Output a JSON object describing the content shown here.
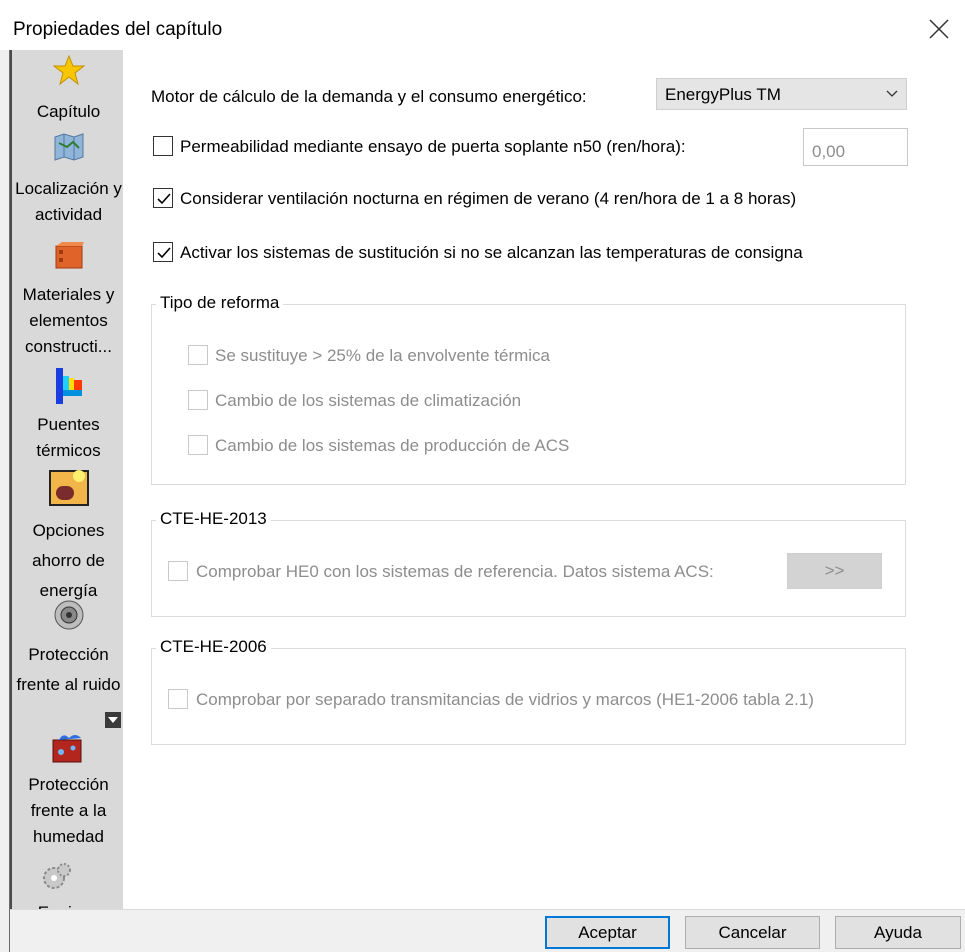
{
  "window": {
    "title": "Propiedades del capítulo"
  },
  "sidebar": {
    "items": [
      {
        "label": "Capítulo",
        "icon": "star-icon"
      },
      {
        "label": "Localización y actividad",
        "icon": "map-icon"
      },
      {
        "label": "Materiales y elementos constructi...",
        "icon": "brick-icon"
      },
      {
        "label": "Puentes térmicos",
        "icon": "thermal-bridge-icon"
      },
      {
        "label": "Opciones ahorro de energía",
        "icon": "energy-saving-icon"
      },
      {
        "label": "Protección frente al ruido",
        "icon": "speaker-icon"
      },
      {
        "label": "Protección frente a la humedad",
        "icon": "humidity-icon"
      },
      {
        "label": "Equipos",
        "icon": "gears-icon"
      }
    ]
  },
  "main": {
    "engine_label": "Motor de cálculo de la demanda y el consumo energético:",
    "engine_value": "EnergyPlus TM",
    "permeability_label": "Permeabilidad mediante ensayo de puerta soplante n50 (ren/hora):",
    "permeability_checked": false,
    "permeability_value": "0,00",
    "night_vent_label": "Considerar ventilación nocturna en régimen de verano (4 ren/hora de 1 a 8 horas)",
    "night_vent_checked": true,
    "substitution_label": "Activar los sistemas de sustitución si no se alcanzan las temperaturas de consigna",
    "substitution_checked": true,
    "reform_group": {
      "title": "Tipo de reforma",
      "options": [
        "Se sustituye > 25% de la envolvente térmica",
        "Cambio de los sistemas de climatización",
        "Cambio de los sistemas de producción de ACS"
      ]
    },
    "he2013_group": {
      "title": "CTE-HE-2013",
      "check_label": "Comprobar HE0 con los sistemas de referencia. Datos sistema ACS:",
      "button_label": ">>"
    },
    "he2006_group": {
      "title": "CTE-HE-2006",
      "check_label": "Comprobar por separado transmitancias de vidrios y marcos (HE1-2006 tabla 2.1)"
    }
  },
  "footer": {
    "accept": "Aceptar",
    "cancel": "Cancelar",
    "help": "Ayuda"
  },
  "colors": {
    "sidebar_bg": "#d9d9d9",
    "accent": "#0078d7",
    "disabled_text": "#8d8d8d"
  }
}
